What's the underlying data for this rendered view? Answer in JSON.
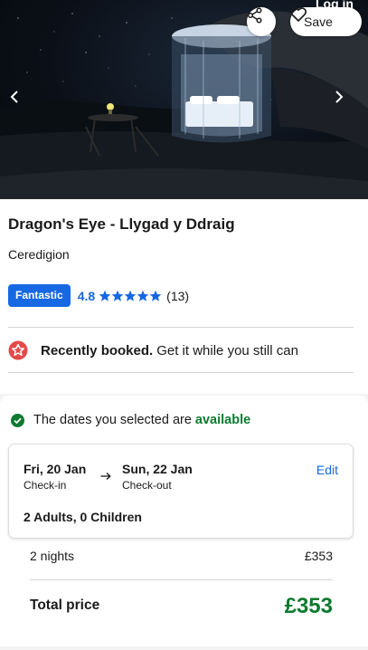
{
  "header": {
    "login_label": "Log in",
    "save_label": "Save"
  },
  "property": {
    "name": "Dragon's Eye - Llygad y Ddraig",
    "location": "Ceredigion",
    "rating_badge": "Fantastic",
    "rating_score": "4.8",
    "rating_stars": 5,
    "review_count": "(13)"
  },
  "notice": {
    "strong": "Recently booked.",
    "text": "Get it while you still can"
  },
  "availability": {
    "prefix": "The dates you selected are",
    "status": "available"
  },
  "dates": {
    "checkin_date": "Fri, 20 Jan",
    "checkin_label": "Check-in",
    "checkout_date": "Sun, 22 Jan",
    "checkout_label": "Check-out",
    "edit_label": "Edit",
    "guests": "2 Adults, 0 Children"
  },
  "pricing": {
    "nights_label": "2 nights",
    "nights_price": "£353",
    "total_label": "Total price",
    "total_price": "£353"
  },
  "colors": {
    "accent_blue": "#1668e3",
    "success_green": "#0d7a2f",
    "alert_red": "#e54a4a"
  },
  "icons": {
    "share": "share-icon",
    "heart": "heart-icon",
    "prev": "chevron-left-icon",
    "next": "chevron-right-icon",
    "star": "star-icon",
    "booked": "star-badge-icon",
    "check": "check-circle-icon",
    "arrow": "arrow-right-icon"
  }
}
